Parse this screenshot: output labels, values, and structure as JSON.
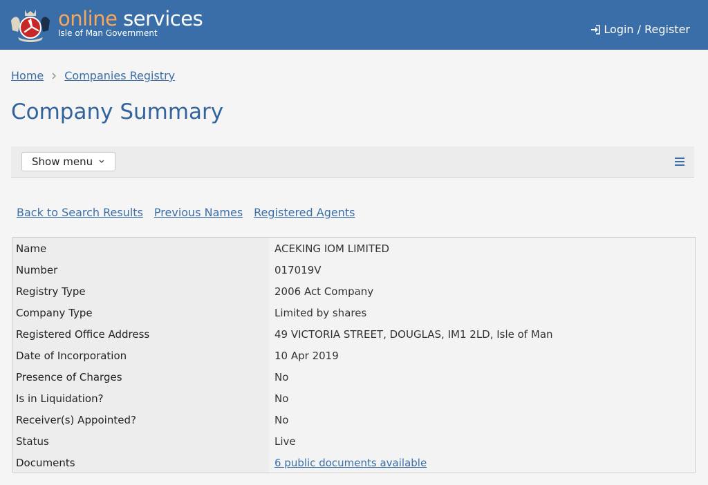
{
  "header": {
    "brand_online": "online",
    "brand_services": " services",
    "brand_sub": "Isle of Man Government",
    "login_label": "Login / Register"
  },
  "breadcrumb": {
    "items": [
      "Home",
      "Companies Registry"
    ]
  },
  "page_title": "Company Summary",
  "menubar": {
    "show_menu_label": "Show menu"
  },
  "links": [
    "Back to Search Results",
    "Previous Names",
    "Registered Agents"
  ],
  "summary": {
    "rows": [
      {
        "label": "Name",
        "value": "ACEKING IOM LIMITED"
      },
      {
        "label": "Number",
        "value": "017019V"
      },
      {
        "label": "Registry Type",
        "value": "2006 Act Company"
      },
      {
        "label": "Company Type",
        "value": "Limited by shares"
      },
      {
        "label": "Registered Office Address",
        "value": "49 VICTORIA STREET, DOUGLAS, IM1 2LD, Isle of Man"
      },
      {
        "label": "Date of Incorporation",
        "value": "10 Apr 2019"
      },
      {
        "label": "Presence of Charges",
        "value": "No"
      },
      {
        "label": "Is in Liquidation?",
        "value": "No"
      },
      {
        "label": "Receiver(s) Appointed?",
        "value": "No"
      },
      {
        "label": "Status",
        "value": "Live"
      },
      {
        "label": "Documents",
        "value": "6 public documents available"
      }
    ]
  },
  "colors": {
    "header_bg": "#3a6ea8",
    "brand_accent": "#f7a65a",
    "link": "#3a6ea8",
    "title": "#33639c"
  },
  "icons": {
    "logo": "isle-of-man-crest-icon",
    "login": "sign-in-icon",
    "breadcrumb_separator": "chevron-right-icon",
    "show_menu": "chevron-down-icon",
    "menu": "hamburger-icon"
  }
}
